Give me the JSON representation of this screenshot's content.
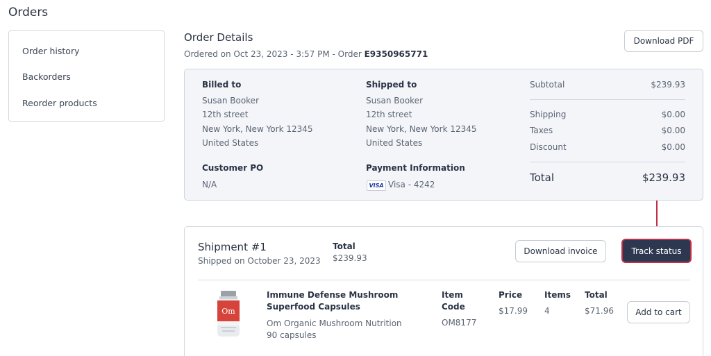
{
  "page": {
    "title": "Orders"
  },
  "sidebar": {
    "items": [
      {
        "label": "Order history"
      },
      {
        "label": "Backorders"
      },
      {
        "label": "Reorder products"
      }
    ]
  },
  "order": {
    "title": "Order Details",
    "ordered_prefix": "Ordered on Oct 23, 2023 - 3:57 PM - Order ",
    "order_number": "E9350965771",
    "download_pdf_label": "Download PDF"
  },
  "billed": {
    "heading": "Billed to",
    "name": "Susan Booker",
    "street": "12th street",
    "city": "New York, New York 12345",
    "country": "United States"
  },
  "shipped": {
    "heading": "Shipped to",
    "name": "Susan Booker",
    "street": "12th street",
    "city": "New York, New York 12345",
    "country": "United States"
  },
  "customer_po": {
    "heading": "Customer PO",
    "value": "N/A"
  },
  "payment": {
    "heading": "Payment Information",
    "card_brand": "VISA",
    "value": "Visa - 4242"
  },
  "totals": {
    "subtotal_label": "Subtotal",
    "subtotal": "$239.93",
    "shipping_label": "Shipping",
    "shipping": "$0.00",
    "taxes_label": "Taxes",
    "taxes": "$0.00",
    "discount_label": "Discount",
    "discount": "$0.00",
    "total_label": "Total",
    "total": "$239.93"
  },
  "shipment": {
    "title": "Shipment #1",
    "shipped_on": "Shipped on October 23, 2023",
    "total_label": "Total",
    "total": "$239.93",
    "download_invoice_label": "Download invoice",
    "track_status_label": "Track status"
  },
  "product": {
    "name": "Immune Defense Mushroom Superfood Capsules",
    "brand": "Om Organic Mushroom Nutrition",
    "size": "90 capsules",
    "item_code_label_1": "Item",
    "item_code_label_2": "Code",
    "item_code": "OM8177",
    "price_label": "Price",
    "price": "$17.99",
    "items_label": "Items",
    "items": "4",
    "total_label": "Total",
    "total": "$71.96",
    "add_to_cart_label": "Add to cart",
    "image_logo_text": "Om"
  },
  "colors": {
    "accent": "#2d3850",
    "highlight": "#c0304a",
    "panel": "#f3f5f9"
  }
}
